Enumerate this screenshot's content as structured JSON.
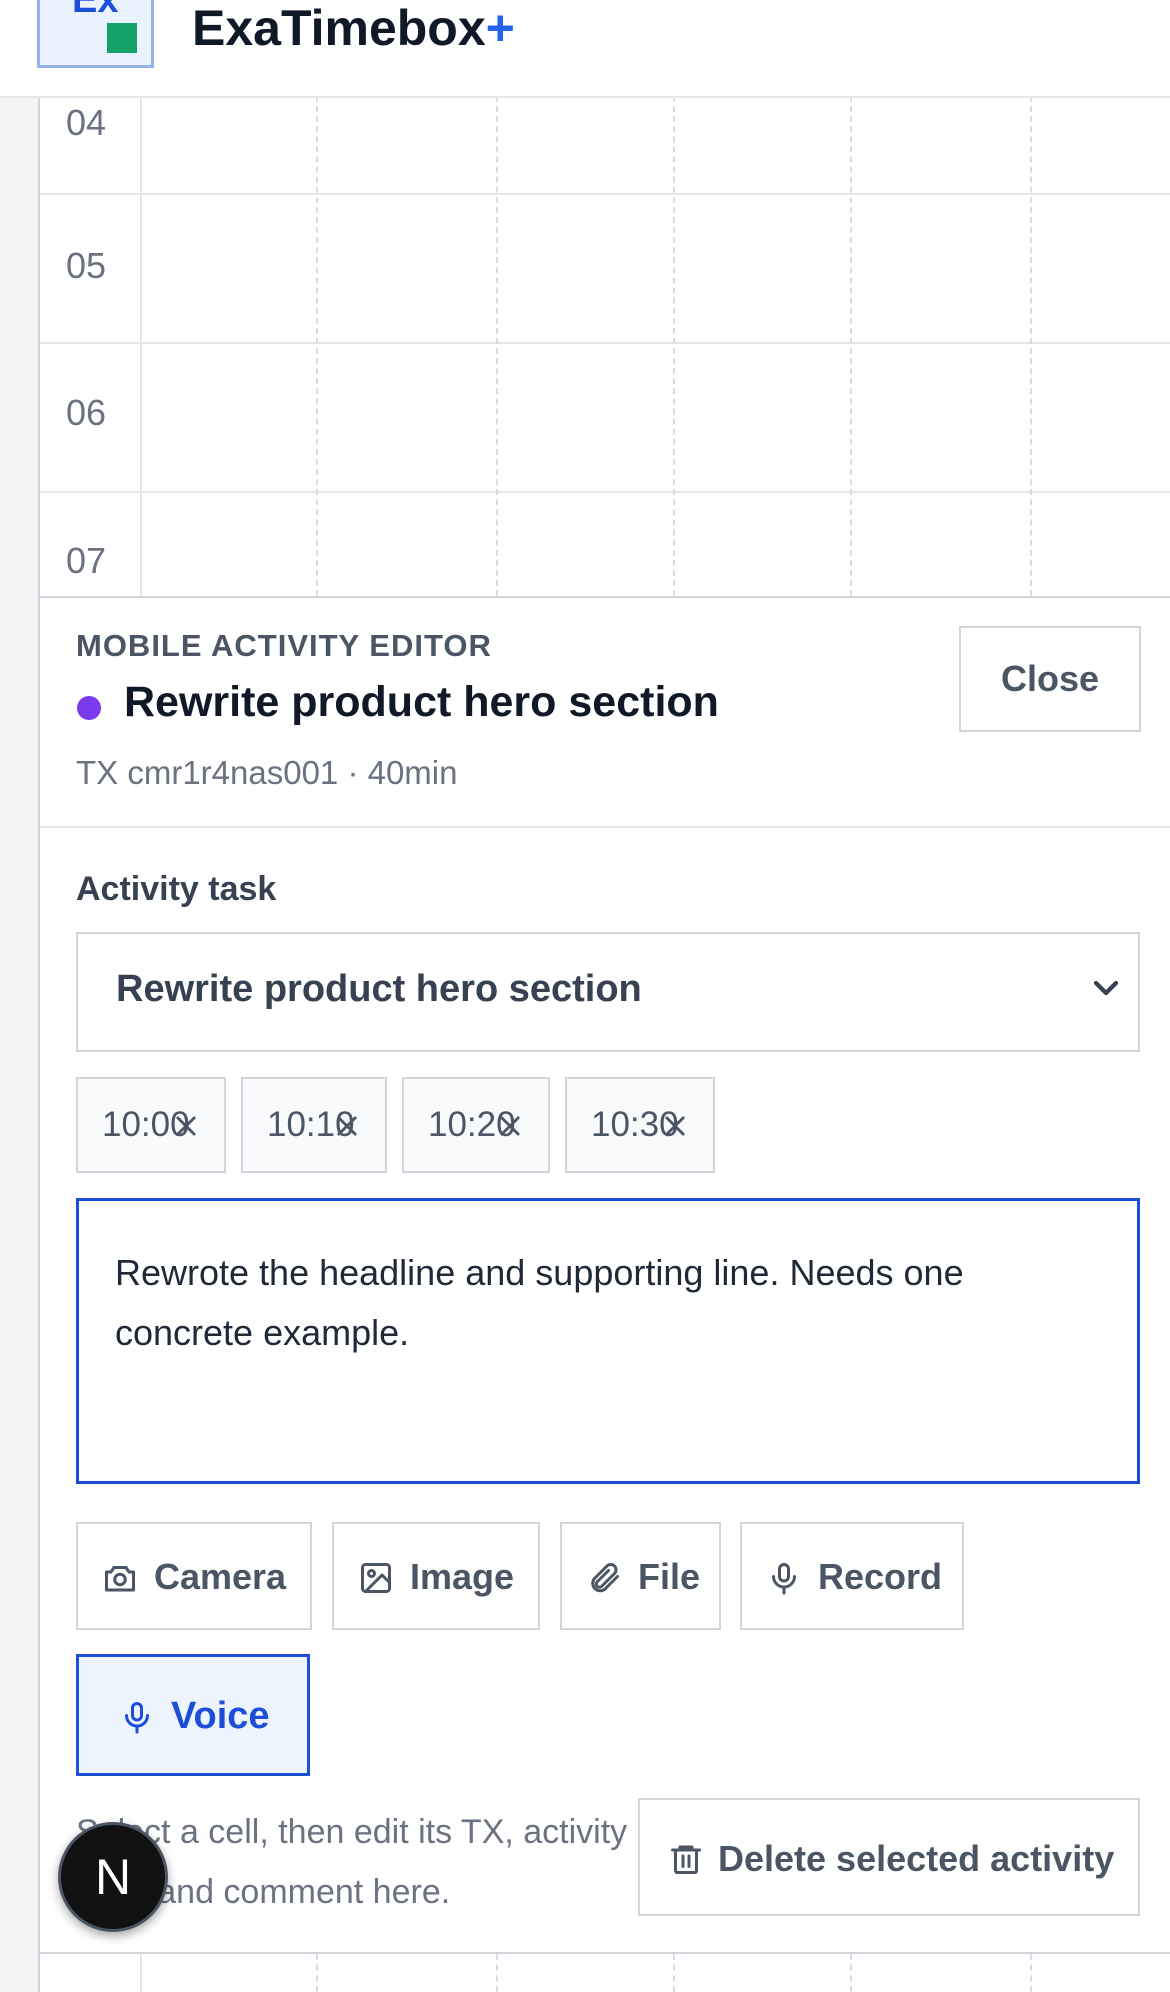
{
  "header": {
    "logo_text": "Ex",
    "app_name": "ExaTimebox",
    "app_plus": "+"
  },
  "calendar": {
    "hours": [
      "04",
      "05",
      "06",
      "07"
    ]
  },
  "editor": {
    "eyebrow": "MOBILE ACTIVITY EDITOR",
    "title": "Rewrite product hero section",
    "color": "#7c3aed",
    "meta": "TX cmr1r4nas001 · 40min",
    "close_label": "Close",
    "task_label": "Activity task",
    "task_selected": "Rewrite product hero section",
    "time_chips": [
      "10:00",
      "10:10",
      "10:20",
      "10:30"
    ],
    "comment": "Rewrote the headline and supporting line. Needs one concrete example.",
    "attachments": {
      "camera": "Camera",
      "image": "Image",
      "file": "File",
      "record": "Record"
    },
    "voice_label": "Voice",
    "hint": "Select a cell, then edit its TX, activity task, and comment here.",
    "delete_label": "Delete selected activity"
  },
  "badge": {
    "letter": "N"
  },
  "colors": {
    "accent": "#1d4ed8",
    "brand_green": "#16a36b",
    "activity_dot": "#7c3aed"
  }
}
